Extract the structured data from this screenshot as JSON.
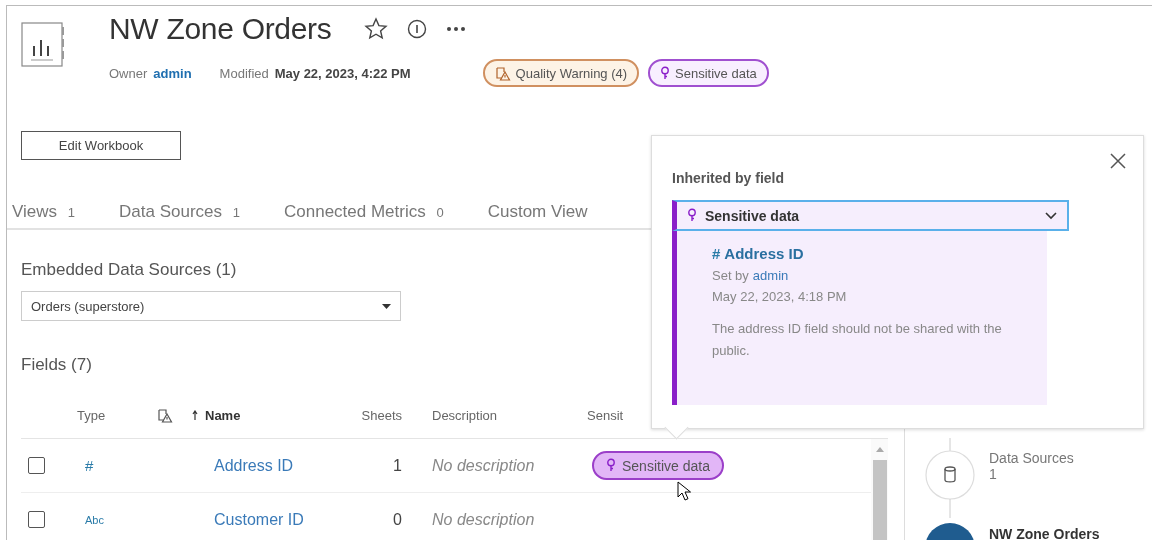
{
  "header": {
    "title": "NW Zone Orders",
    "owner_label": "Owner",
    "owner": "admin",
    "modified_label": "Modified",
    "modified": "May 22, 2023, 4:22 PM",
    "badges": [
      {
        "kind": "quality",
        "label": "Quality Warning (4)"
      },
      {
        "kind": "sensitive",
        "label": "Sensitive data"
      }
    ]
  },
  "edit_button": "Edit Workbook",
  "tabs": [
    {
      "label": "Views",
      "count": "1"
    },
    {
      "label": "Data Sources",
      "count": "1"
    },
    {
      "label": "Connected Metrics",
      "count": "0"
    },
    {
      "label": "Custom View"
    }
  ],
  "embedded": {
    "heading": "Embedded Data Sources (1)",
    "value": "Orders (superstore)"
  },
  "fields": {
    "heading": "Fields (7)",
    "columns": [
      {
        "kind": "blank"
      },
      {
        "kind": "text",
        "label": "Type"
      },
      {
        "kind": "warning"
      },
      {
        "kind": "sorted",
        "label": "Name"
      },
      {
        "kind": "number",
        "label": "Sheets"
      },
      {
        "kind": "text",
        "label": "Description"
      },
      {
        "kind": "text",
        "label": "Sensit"
      }
    ],
    "rows": [
      {
        "checked": false,
        "type": "#",
        "name": "Address ID",
        "sheets": "1",
        "description": "No description",
        "sensitivity": "Sensitive data"
      },
      {
        "checked": false,
        "type": "Abc",
        "name": "Customer ID",
        "sheets": "0",
        "description": "No description"
      }
    ]
  },
  "popover": {
    "heading": "Inherited by field",
    "select": "Sensitive data",
    "field_type": "#",
    "field": "Address ID",
    "set_by_label": "Set by",
    "set_by": "admin",
    "date": "May 22, 2023, 4:18 PM",
    "description": "The address ID field should not be shared with the public."
  },
  "lineage": [
    {
      "kind": "datasource",
      "label": "Data Sources",
      "count": "1"
    },
    {
      "kind": "workbook",
      "label": "NW Zone Orders"
    }
  ]
}
